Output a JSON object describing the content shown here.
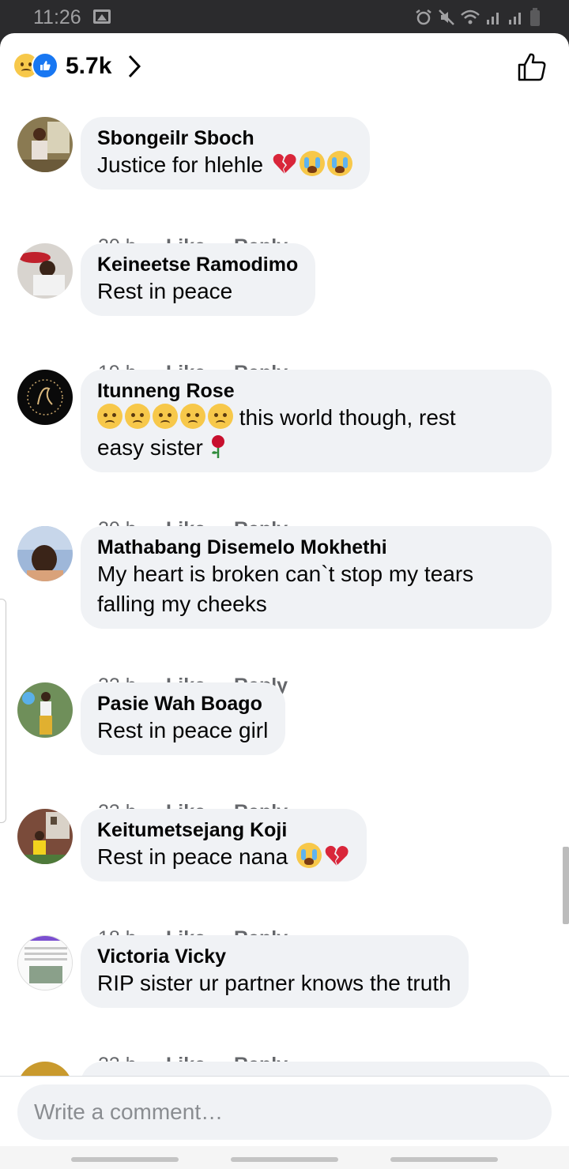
{
  "status_bar": {
    "time": "11:26"
  },
  "header": {
    "reaction_count": "5.7k"
  },
  "comments": [
    {
      "author": "Sbongeilr Sboch",
      "text": "Justice for hlehle",
      "time": "20 h",
      "like": "Like",
      "reply": "Reply"
    },
    {
      "author": "Keineetse Ramodimo",
      "text": "Rest in peace",
      "time": "19 h",
      "like": "Like",
      "reply": "Reply"
    },
    {
      "author": "Itunneng Rose",
      "text": "this world though, rest",
      "text2": "easy sister",
      "time": "20 h",
      "like": "Like",
      "reply": "Reply"
    },
    {
      "author": "Mathabang Disemelo Mokhethi",
      "text": "My heart is broken can`t stop my tears",
      "text2": "falling my cheeks",
      "time": "22 h",
      "like": "Like",
      "reply": "Reply"
    },
    {
      "author": "Pasie Wah Boago",
      "text": "Rest in peace girl",
      "time": "23 h",
      "like": "Like",
      "reply": "Reply"
    },
    {
      "author": "Keitumetsejang Koji",
      "text": "Rest in peace nana",
      "time": "18 h",
      "like": "Like",
      "reply": "Reply"
    },
    {
      "author": "Victoria Vicky",
      "text": "RIP sister ur partner knows the truth",
      "time": "23 h",
      "like": "Like",
      "reply": "Reply"
    }
  ],
  "composer": {
    "placeholder": "Write a comment…"
  },
  "icons": {
    "status": [
      "gallery-icon",
      "alarm-icon",
      "mute-icon",
      "wifi-icon",
      "signal-icon",
      "battery-icon"
    ],
    "header": [
      "sad-reaction-icon",
      "like-reaction-icon",
      "chevron-right-icon",
      "thumbs-up-icon"
    ]
  },
  "colors": {
    "bubble": "#f0f2f5",
    "like_blue": "#1877f2",
    "muted_text": "#65676b"
  }
}
